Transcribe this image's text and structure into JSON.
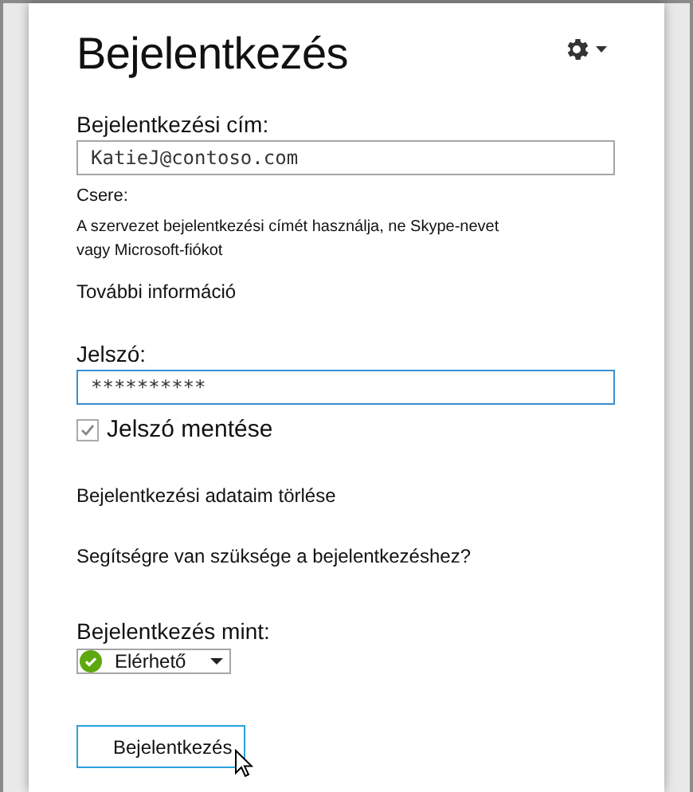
{
  "title": "Bejelentkezés",
  "address": {
    "label": "Bejelentkezési cím:",
    "value": "KatieJ@contoso.com"
  },
  "note": {
    "heading": "Csere:",
    "text": "A szervezet bejelentkezési címét használja, ne Skype-nevet vagy Microsoft-fiókot",
    "link": "További információ"
  },
  "password": {
    "label": "Jelszó:",
    "value": "**********",
    "focused": true
  },
  "save_password": {
    "label": "Jelszó mentése",
    "checked": true
  },
  "links": [
    "Bejelentkezési adataim törlése",
    "Segítségre van szüksége a bejelentkezéshez?"
  ],
  "presence": {
    "label": "Bejelentkezés mint:",
    "value": "Elérhető"
  },
  "sign_in_button": {
    "label": "Bejelentkezés",
    "hovered": true
  }
}
